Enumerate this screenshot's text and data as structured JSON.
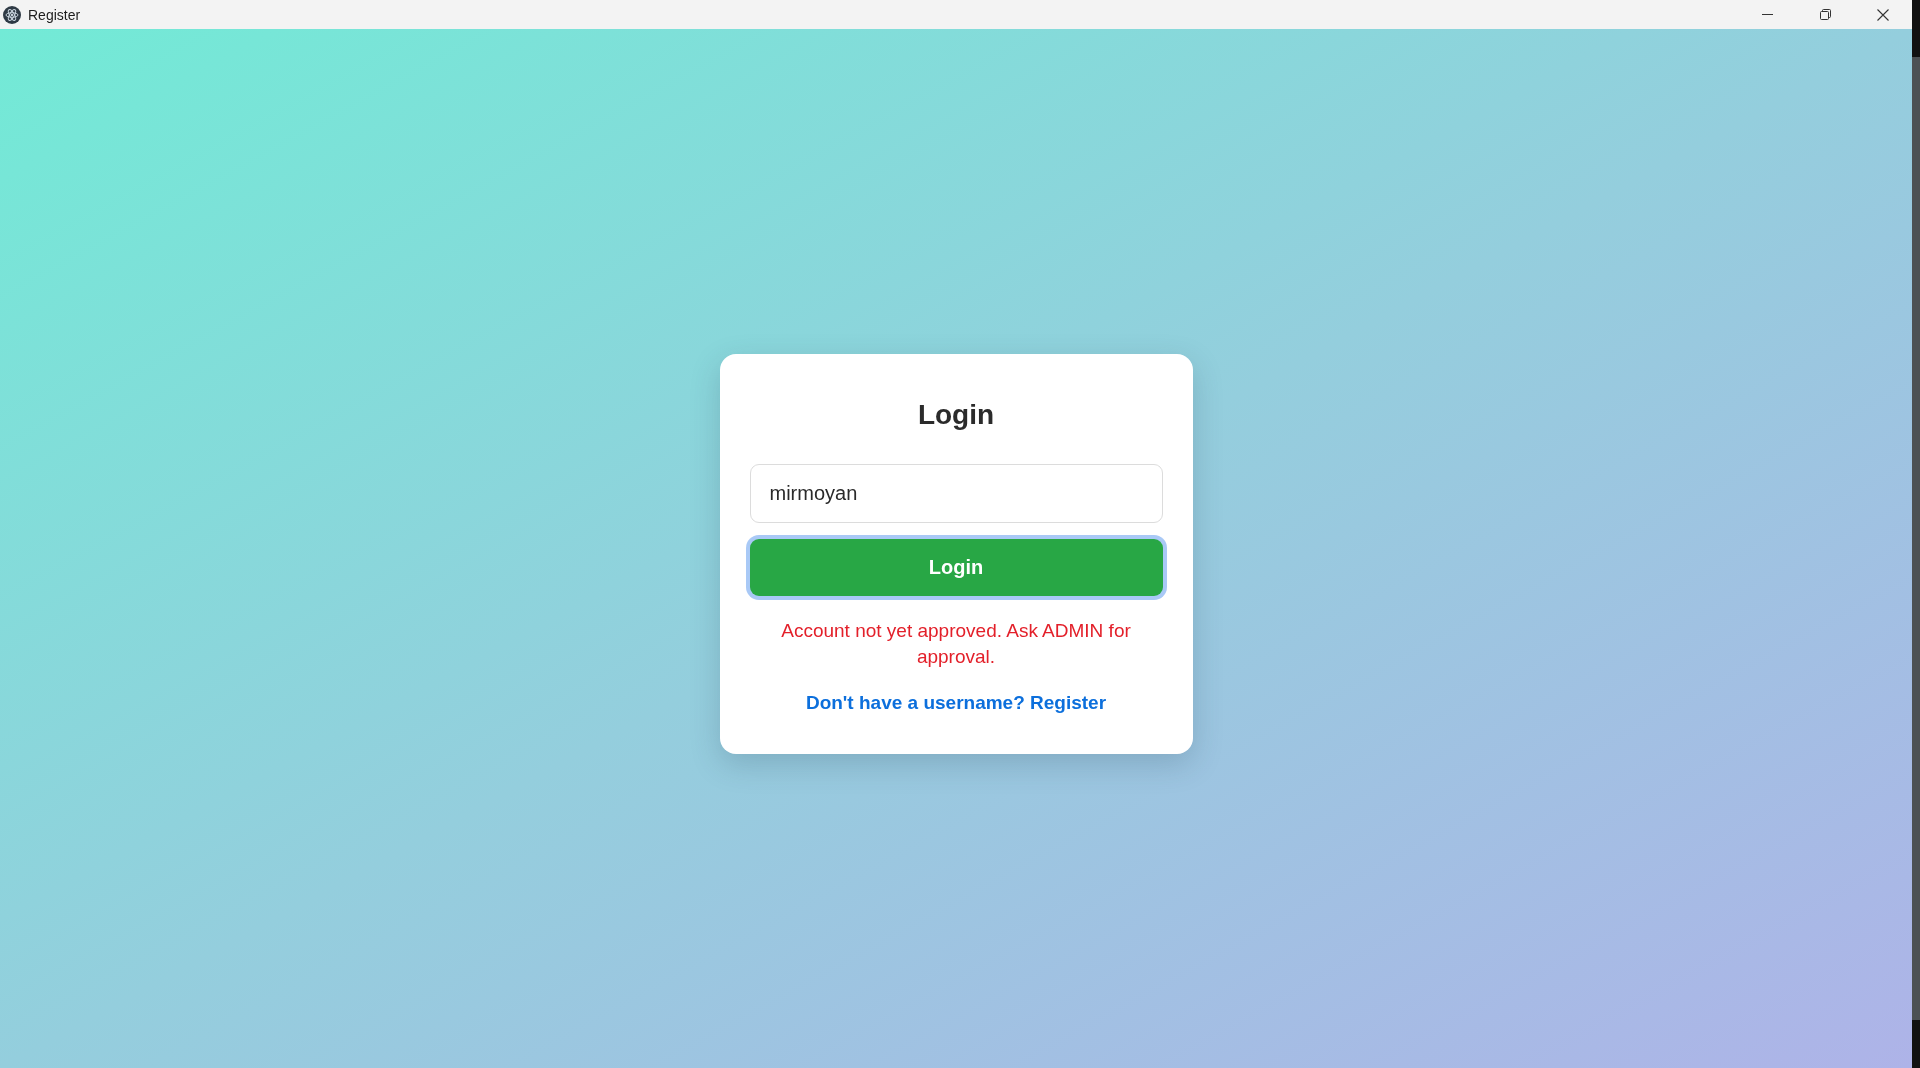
{
  "window": {
    "title": "Register"
  },
  "login_card": {
    "title": "Login",
    "username_field": {
      "value": "mirmoyan"
    },
    "login_button": {
      "label": "Login",
      "focused": true
    },
    "error_message": "Account not yet approved. Ask ADMIN for approval.",
    "register_link": "Don't have a username? Register"
  }
}
